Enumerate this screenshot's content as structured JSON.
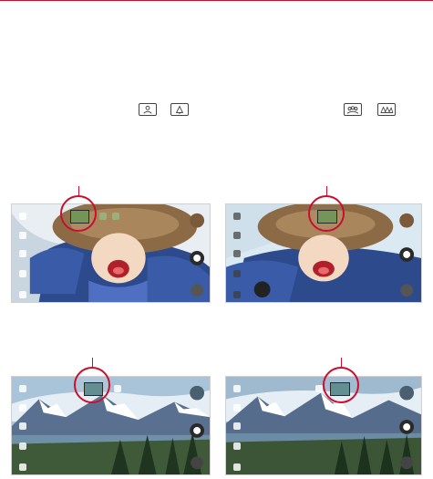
{
  "colors": {
    "accent_red": "#c8102e",
    "sky_light": "#dbe9f2",
    "jacket_blue": "#2c4a8c",
    "hat_brown": "#8b6a45",
    "mountain_blue": "#3d5a80",
    "forest_green": "#2d4a2a",
    "camera_button": "#2a2a2a"
  },
  "icons": {
    "portrait": "portrait-icon",
    "landscape": "landscape-icon",
    "group": "group-portrait-icon",
    "wide": "wide-landscape-icon",
    "shutter": "camera-shutter-icon",
    "settings": "gear-icon",
    "back": "back-arrow-icon"
  }
}
